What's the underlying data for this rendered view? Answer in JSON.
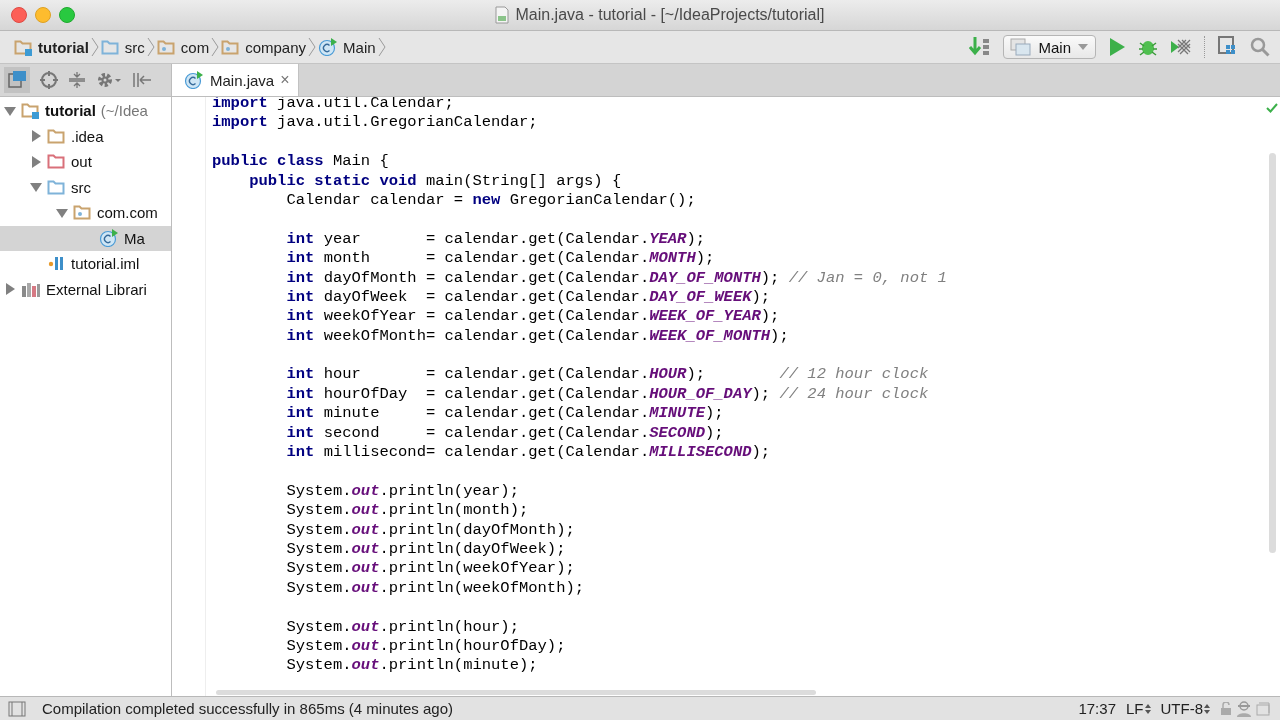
{
  "window": {
    "title": "Main.java - tutorial - [~/IdeaProjects/tutorial]"
  },
  "breadcrumbs": [
    {
      "label": "tutorial",
      "kind": "project"
    },
    {
      "label": "src",
      "kind": "source"
    },
    {
      "label": "com",
      "kind": "package"
    },
    {
      "label": "company",
      "kind": "package"
    },
    {
      "label": "Main",
      "kind": "class"
    }
  ],
  "run_config": {
    "label": "Main"
  },
  "project_tree": [
    {
      "label": "tutorial",
      "hint": "(~/Idea",
      "kind": "project",
      "expanded": true,
      "selected": false,
      "children": [
        {
          "label": ".idea",
          "kind": "folder",
          "expanded": false,
          "selected": false
        },
        {
          "label": "out",
          "kind": "excluded",
          "expanded": false,
          "selected": false
        },
        {
          "label": "src",
          "kind": "source",
          "expanded": true,
          "selected": false,
          "children": [
            {
              "label": "com.com",
              "kind": "package",
              "expanded": true,
              "selected": false,
              "children": [
                {
                  "label": "Ma",
                  "kind": "class",
                  "selected": true
                }
              ]
            }
          ]
        },
        {
          "label": "tutorial.iml",
          "kind": "module",
          "selected": false
        }
      ]
    },
    {
      "label": "External Librari",
      "kind": "libraries",
      "expanded": false,
      "selected": false
    }
  ],
  "editor": {
    "tab": {
      "label": "Main.java",
      "close": "×",
      "selected": true
    },
    "blocks": [
      {
        "lines": [
          {
            "tokens": [
              {
                "kind": "keyword",
                "text": "import"
              },
              {
                "kind": "plain",
                "text": " java.util.Calendar;"
              }
            ]
          },
          {
            "tokens": [
              {
                "kind": "keyword",
                "text": "import"
              },
              {
                "kind": "plain",
                "text": " java.util.GregorianCalendar;"
              }
            ]
          }
        ]
      },
      {
        "lines": [
          {
            "tokens": [
              {
                "kind": "keyword",
                "text": "public class"
              },
              {
                "kind": "plain",
                "text": " Main {"
              }
            ]
          },
          {
            "tokens": [
              {
                "kind": "keyword",
                "text": "    public static void"
              },
              {
                "kind": "plain",
                "text": " main(String[] args) {"
              }
            ]
          },
          {
            "tokens": [
              {
                "kind": "plain",
                "text": "        Calendar calendar = "
              },
              {
                "kind": "keyword",
                "text": "new"
              },
              {
                "kind": "plain",
                "text": " GregorianCalendar();"
              }
            ]
          }
        ]
      },
      {
        "lines": [
          {
            "tokens": [
              {
                "kind": "keyword",
                "text": "        int"
              },
              {
                "kind": "plain",
                "text": " year       = calendar.get(Calendar."
              },
              {
                "kind": "constant",
                "text": "YEAR"
              },
              {
                "kind": "plain",
                "text": ");"
              }
            ]
          },
          {
            "tokens": [
              {
                "kind": "keyword",
                "text": "        int"
              },
              {
                "kind": "plain",
                "text": " month      = calendar.get(Calendar."
              },
              {
                "kind": "constant",
                "text": "MONTH"
              },
              {
                "kind": "plain",
                "text": ");"
              }
            ]
          },
          {
            "tokens": [
              {
                "kind": "keyword",
                "text": "        int"
              },
              {
                "kind": "plain",
                "text": " dayOfMonth = calendar.get(Calendar."
              },
              {
                "kind": "constant",
                "text": "DAY_OF_MONTH"
              },
              {
                "kind": "plain",
                "text": "); "
              },
              {
                "kind": "comment",
                "text": "// Jan = 0, not 1"
              }
            ]
          },
          {
            "tokens": [
              {
                "kind": "keyword",
                "text": "        int"
              },
              {
                "kind": "plain",
                "text": " dayOfWeek  = calendar.get(Calendar."
              },
              {
                "kind": "constant",
                "text": "DAY_OF_WEEK"
              },
              {
                "kind": "plain",
                "text": ");"
              }
            ]
          },
          {
            "tokens": [
              {
                "kind": "keyword",
                "text": "        int"
              },
              {
                "kind": "plain",
                "text": " weekOfYear = calendar.get(Calendar."
              },
              {
                "kind": "constant",
                "text": "WEEK_OF_YEAR"
              },
              {
                "kind": "plain",
                "text": ");"
              }
            ]
          },
          {
            "tokens": [
              {
                "kind": "keyword",
                "text": "        int"
              },
              {
                "kind": "plain",
                "text": " weekOfMonth= calendar.get(Calendar."
              },
              {
                "kind": "constant",
                "text": "WEEK_OF_MONTH"
              },
              {
                "kind": "plain",
                "text": ");"
              }
            ]
          }
        ]
      },
      {
        "lines": [
          {
            "tokens": [
              {
                "kind": "keyword",
                "text": "        int"
              },
              {
                "kind": "plain",
                "text": " hour       = calendar.get(Calendar."
              },
              {
                "kind": "constant",
                "text": "HOUR"
              },
              {
                "kind": "plain",
                "text": ");        "
              },
              {
                "kind": "comment",
                "text": "// 12 hour clock"
              }
            ]
          },
          {
            "tokens": [
              {
                "kind": "keyword",
                "text": "        int"
              },
              {
                "kind": "plain",
                "text": " hourOfDay  = calendar.get(Calendar."
              },
              {
                "kind": "constant",
                "text": "HOUR_OF_DAY"
              },
              {
                "kind": "plain",
                "text": "); "
              },
              {
                "kind": "comment",
                "text": "// 24 hour clock"
              }
            ]
          },
          {
            "tokens": [
              {
                "kind": "keyword",
                "text": "        int"
              },
              {
                "kind": "plain",
                "text": " minute     = calendar.get(Calendar."
              },
              {
                "kind": "constant",
                "text": "MINUTE"
              },
              {
                "kind": "plain",
                "text": ");"
              }
            ]
          },
          {
            "tokens": [
              {
                "kind": "keyword",
                "text": "        int"
              },
              {
                "kind": "plain",
                "text": " second     = calendar.get(Calendar."
              },
              {
                "kind": "constant",
                "text": "SECOND"
              },
              {
                "kind": "plain",
                "text": ");"
              }
            ]
          },
          {
            "tokens": [
              {
                "kind": "keyword",
                "text": "        int"
              },
              {
                "kind": "plain",
                "text": " millisecond= calendar.get(Calendar."
              },
              {
                "kind": "constant",
                "text": "MILLISECOND"
              },
              {
                "kind": "plain",
                "text": ");"
              }
            ]
          }
        ]
      },
      {
        "lines": [
          {
            "tokens": [
              {
                "kind": "plain",
                "text": "        System."
              },
              {
                "kind": "constant",
                "text": "out"
              },
              {
                "kind": "plain",
                "text": ".println(year);"
              }
            ]
          },
          {
            "tokens": [
              {
                "kind": "plain",
                "text": "        System."
              },
              {
                "kind": "constant",
                "text": "out"
              },
              {
                "kind": "plain",
                "text": ".println(month);"
              }
            ]
          },
          {
            "tokens": [
              {
                "kind": "plain",
                "text": "        System."
              },
              {
                "kind": "constant",
                "text": "out"
              },
              {
                "kind": "plain",
                "text": ".println(dayOfMonth);"
              }
            ]
          },
          {
            "tokens": [
              {
                "kind": "plain",
                "text": "        System."
              },
              {
                "kind": "constant",
                "text": "out"
              },
              {
                "kind": "plain",
                "text": ".println(dayOfWeek);"
              }
            ]
          },
          {
            "tokens": [
              {
                "kind": "plain",
                "text": "        System."
              },
              {
                "kind": "constant",
                "text": "out"
              },
              {
                "kind": "plain",
                "text": ".println(weekOfYear);"
              }
            ]
          },
          {
            "tokens": [
              {
                "kind": "plain",
                "text": "        System."
              },
              {
                "kind": "constant",
                "text": "out"
              },
              {
                "kind": "plain",
                "text": ".println(weekOfMonth);"
              }
            ]
          }
        ]
      },
      {
        "lines": [
          {
            "tokens": [
              {
                "kind": "plain",
                "text": "        System."
              },
              {
                "kind": "constant",
                "text": "out"
              },
              {
                "kind": "plain",
                "text": ".println(hour);"
              }
            ]
          },
          {
            "tokens": [
              {
                "kind": "plain",
                "text": "        System."
              },
              {
                "kind": "constant",
                "text": "out"
              },
              {
                "kind": "plain",
                "text": ".println(hourOfDay);"
              }
            ]
          },
          {
            "tokens": [
              {
                "kind": "plain",
                "text": "        System."
              },
              {
                "kind": "constant",
                "text": "out"
              },
              {
                "kind": "plain",
                "text": ".println(minute);"
              }
            ]
          }
        ]
      }
    ]
  },
  "status_bar": {
    "message": "Compilation completed successfully in 865ms (4 minutes ago)",
    "position": "17:37",
    "line_separator": "LF",
    "encoding": "UTF-8"
  }
}
